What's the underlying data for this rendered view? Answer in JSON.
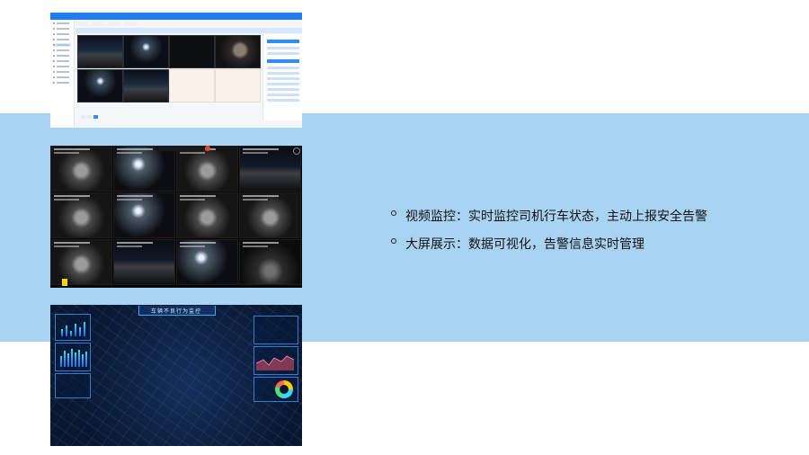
{
  "features": [
    {
      "text": "视频监控：实时监控司机行车状态，主动上报安全告警",
      "icon": "circle-bullet-icon"
    },
    {
      "text": "大屏展示：数据可视化，告警信息实时管理",
      "icon": "circle-bullet-icon"
    }
  ],
  "screenshots": {
    "web_app": {
      "content": "web video monitoring console with camera grid"
    },
    "camera_wall": {
      "content": "multi-camera live wall of driver and road views"
    },
    "dashboard": {
      "title": "车辆不良行为监控"
    }
  },
  "colors": {
    "band": "#a9d4f1",
    "app_primary": "#1f7ee8",
    "dashboard_bg": "#0a1730",
    "dashboard_accent": "#3ea9ff"
  }
}
